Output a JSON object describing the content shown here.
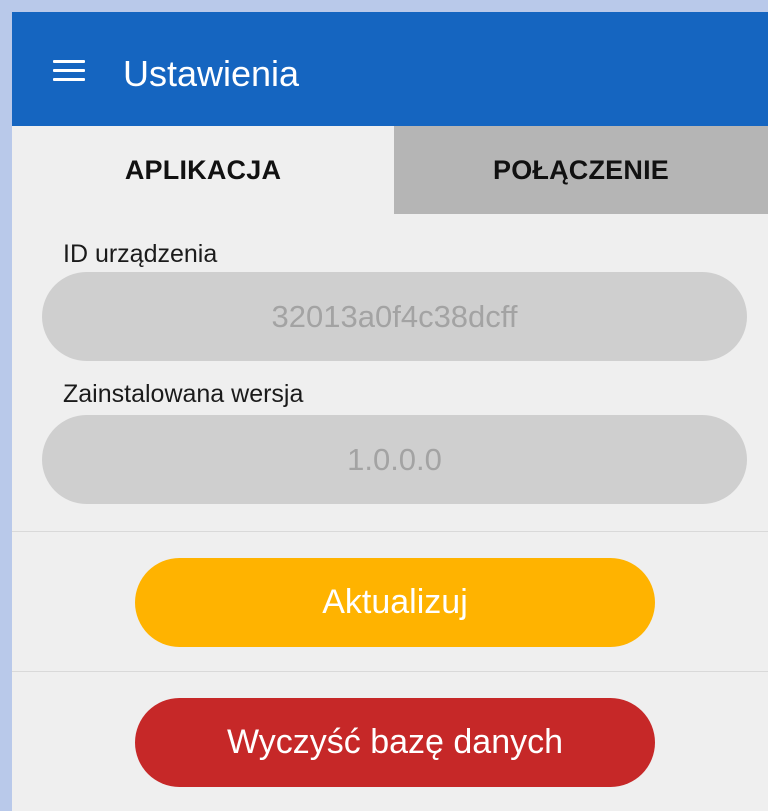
{
  "appbar": {
    "title": "Ustawienia",
    "menu_icon": "hamburger-menu-icon",
    "color": "#1565c0"
  },
  "tabs": [
    {
      "label": "APLIKACJA",
      "selected": true
    },
    {
      "label": "POŁĄCZENIE",
      "selected": false
    }
  ],
  "device_id": {
    "label": "ID urządzenia",
    "value": "32013a0f4c38dcff"
  },
  "installed_version": {
    "label": "Zainstalowana wersja",
    "value": "1.0.0.0"
  },
  "buttons": {
    "update_label": "Aktualizuj",
    "update_color": "#ffb300",
    "clear_db_label": "Wyczyść bazę danych",
    "clear_db_color": "#c62828"
  }
}
